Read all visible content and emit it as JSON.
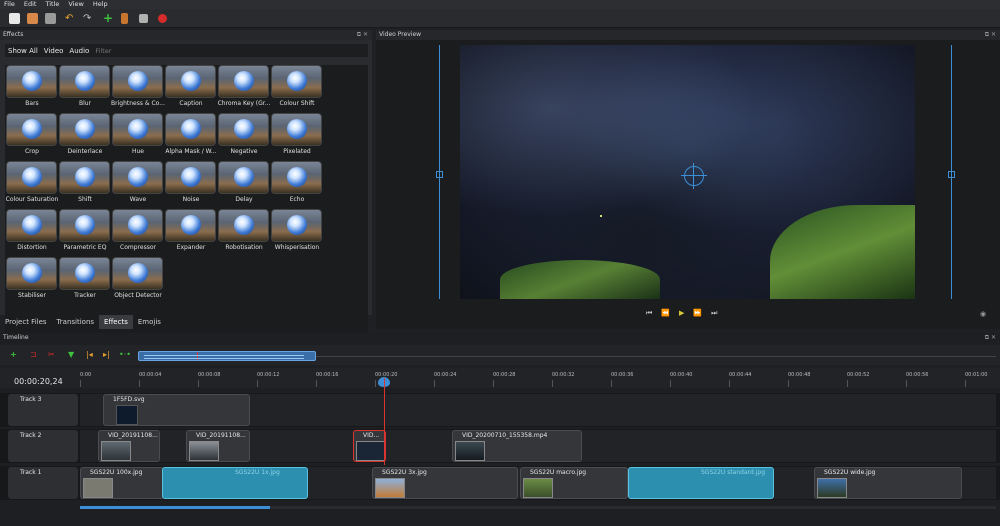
{
  "menu": [
    "File",
    "Edit",
    "Title",
    "View",
    "Help"
  ],
  "toolbar": [
    "new-project-icon",
    "open-project-icon",
    "save-project-icon",
    "undo-icon",
    "redo-icon",
    "add-files-icon",
    "profile-icon",
    "fullscreen-icon",
    "record-icon"
  ],
  "effects_panel": {
    "title": "Effects",
    "filters": [
      "Show All",
      "Video",
      "Audio"
    ],
    "filter_placeholder": "Filter",
    "items": [
      "Bars",
      "Blur",
      "Brightness & Co...",
      "Caption",
      "Chroma Key (Gr...",
      "Colour Shift",
      "Crop",
      "Deinterlace",
      "Hue",
      "Alpha Mask / W...",
      "Negative",
      "Pixelated",
      "Colour Saturation",
      "Shift",
      "Wave",
      "Noise",
      "Delay",
      "Echo",
      "Distortion",
      "Parametric EQ",
      "Compressor",
      "Expander",
      "Robotisation",
      "Whisperisation",
      "Stabiliser",
      "Tracker",
      "Object Detector"
    ]
  },
  "bottom_tabs": [
    "Project Files",
    "Transitions",
    "Effects",
    "Emojis"
  ],
  "active_tab": "Effects",
  "preview_panel": {
    "title": "Video Preview"
  },
  "timeline": {
    "title": "Timeline",
    "timecode": "00:00:20,24",
    "ruler_ticks": [
      "0:00",
      "00:00:04",
      "00:00:08",
      "00:00:12",
      "00:00:16",
      "00:00:20",
      "00:00:24",
      "00:00:28",
      "00:00:32",
      "00:00:36",
      "00:00:40",
      "00:00:44",
      "00:00:48",
      "00:00:52",
      "00:00:56",
      "00:01:00"
    ],
    "tracks": [
      {
        "name": "Track 3",
        "clips": [
          "1F5FD.svg"
        ]
      },
      {
        "name": "Track 2",
        "clips": [
          "VID_20191108...",
          "VID_20191108...",
          "VID...",
          "VID_20200710_155358.mp4"
        ]
      },
      {
        "name": "Track 1",
        "clips": [
          "SGS22U 100x.jpg",
          "SGS22U 3x.jpg",
          "SGS22U macro.jpg",
          "SGS22U wide.jpg"
        ],
        "transitions": [
          "SGS22U 1x.jpg",
          "SGS22U standard.jpg"
        ]
      }
    ]
  }
}
